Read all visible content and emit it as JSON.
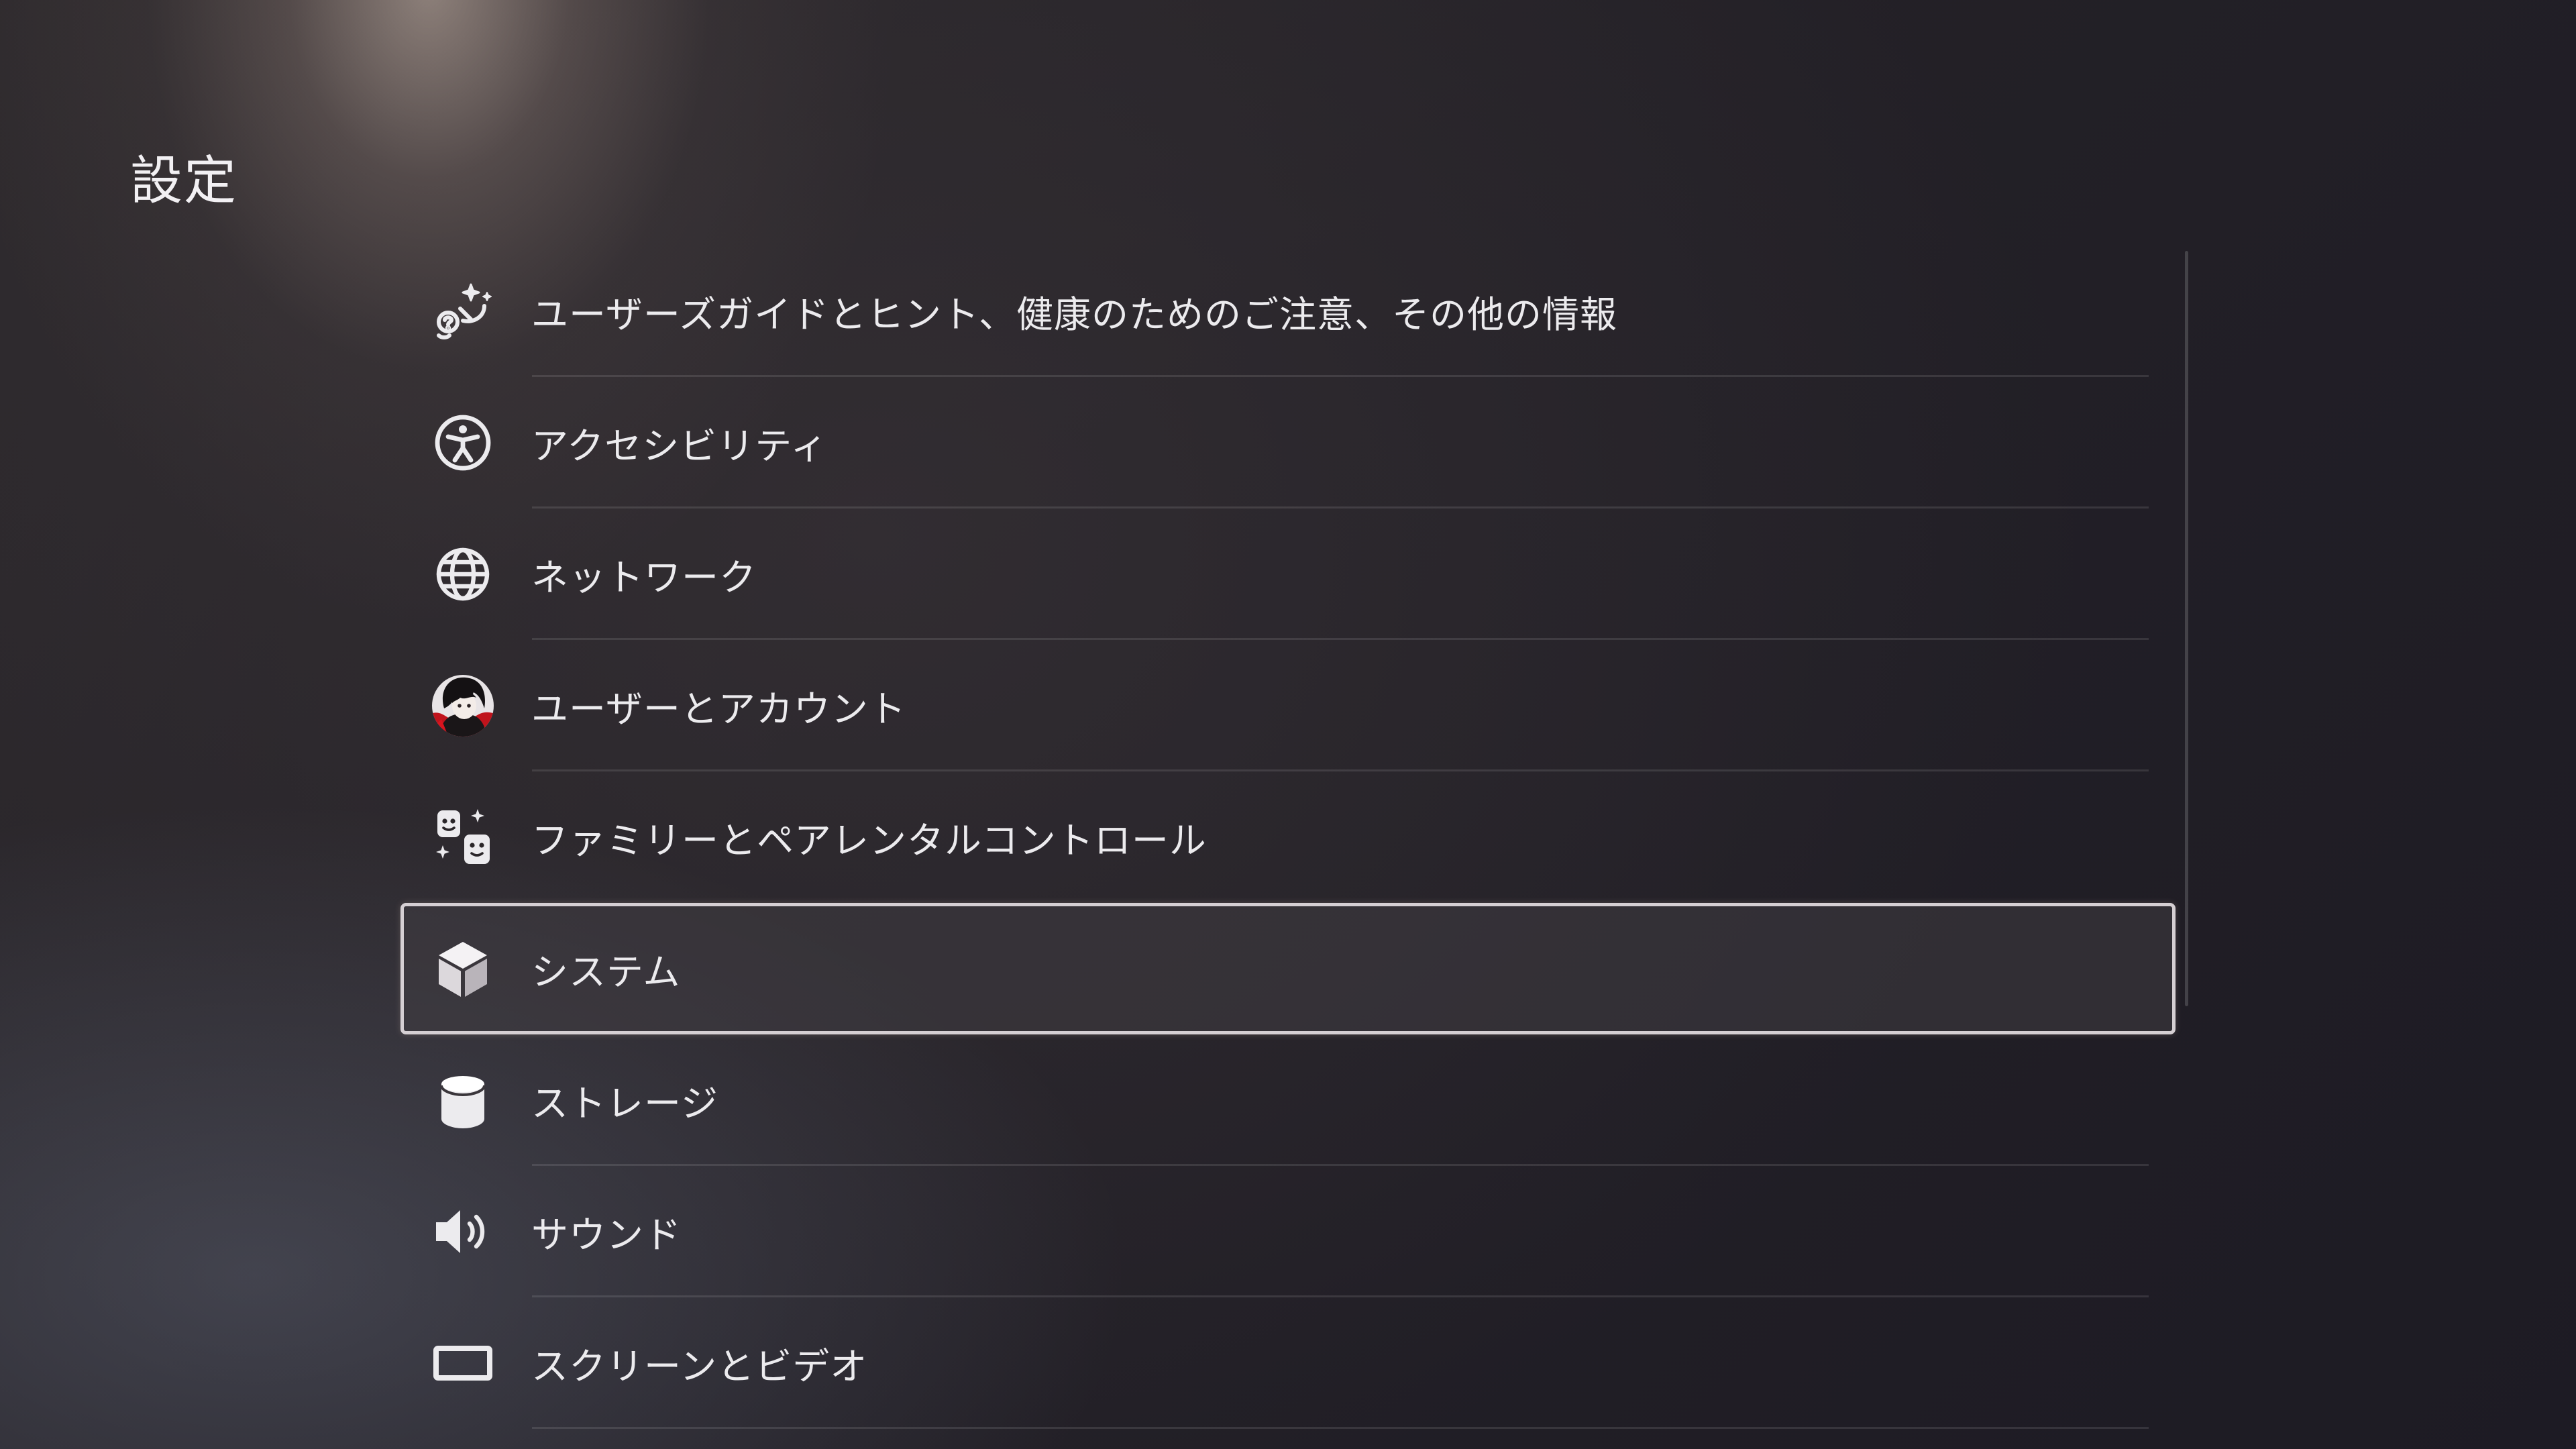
{
  "page": {
    "title": "設定"
  },
  "menu": {
    "items": [
      {
        "label": "ユーザーズガイドとヒント、健康のためのご注意、その他の情報",
        "icon": "tips-sparkle-icon"
      },
      {
        "label": "アクセシビリティ",
        "icon": "accessibility-icon"
      },
      {
        "label": "ネットワーク",
        "icon": "globe-icon"
      },
      {
        "label": "ユーザーとアカウント",
        "icon": "user-avatar"
      },
      {
        "label": "ファミリーとペアレンタルコントロール",
        "icon": "family-icon"
      },
      {
        "label": "システム",
        "icon": "cube-icon",
        "selected": true
      },
      {
        "label": "ストレージ",
        "icon": "storage-cylinder-icon"
      },
      {
        "label": "サウンド",
        "icon": "speaker-icon"
      },
      {
        "label": "スクリーンとビデオ",
        "icon": "screen-icon"
      }
    ]
  },
  "colors": {
    "selection_border": "#d5cfd3",
    "text": "#ecebee",
    "background": "#222028"
  }
}
